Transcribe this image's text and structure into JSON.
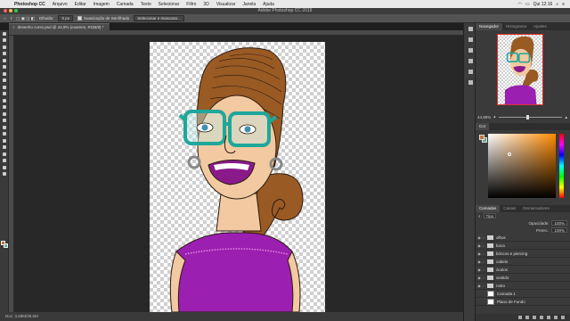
{
  "menubar": {
    "app_name": "Photoshop CC",
    "items": [
      "Arquivo",
      "Editar",
      "Imagem",
      "Camada",
      "Texto",
      "Selecionar",
      "Filtro",
      "3D",
      "Visualizar",
      "Janela",
      "Ajuda"
    ],
    "clock": "Qui 12:16"
  },
  "window": {
    "title": "Adobe Photoshop CC 2019"
  },
  "options": {
    "feather_label": "Difusão:",
    "feather_value": "0 px",
    "antialias_label": "Suavização de Serrilhado",
    "select_mask_button": "Selecionar e mascarar..."
  },
  "document": {
    "tab_label": "desenho curso.psd @ 44,9% (exames, RGB/8) *"
  },
  "status": {
    "text": "Doc: 3,59M/39,5M"
  },
  "navigator": {
    "tabs": [
      "Navegador",
      "Histograma",
      "Ajustes"
    ],
    "zoom": "44,88%",
    "zoom_fraction": 0.45
  },
  "color_panel": {
    "tabs": [
      "Cor"
    ],
    "fg_color": "#c0763a",
    "bg_color": "#67a98e"
  },
  "layers": {
    "tabs": [
      "Camadas",
      "Canais",
      "Demarcadores"
    ],
    "kind_label": "Tipo",
    "opacity_label": "Opacidade:",
    "opacity_value": "100%",
    "fill_label": "Preen.:",
    "fill_value": "100%",
    "items": [
      {
        "name": "olhos",
        "type": "group"
      },
      {
        "name": "boca",
        "type": "group"
      },
      {
        "name": "brincos e piercing",
        "type": "group"
      },
      {
        "name": "cabelo",
        "type": "group"
      },
      {
        "name": "óculos",
        "type": "group"
      },
      {
        "name": "vestido",
        "type": "group"
      },
      {
        "name": "rosto",
        "type": "group"
      },
      {
        "name": "Camada 1",
        "type": "layer"
      },
      {
        "name": "Plano de Fundo",
        "type": "layer"
      }
    ]
  }
}
